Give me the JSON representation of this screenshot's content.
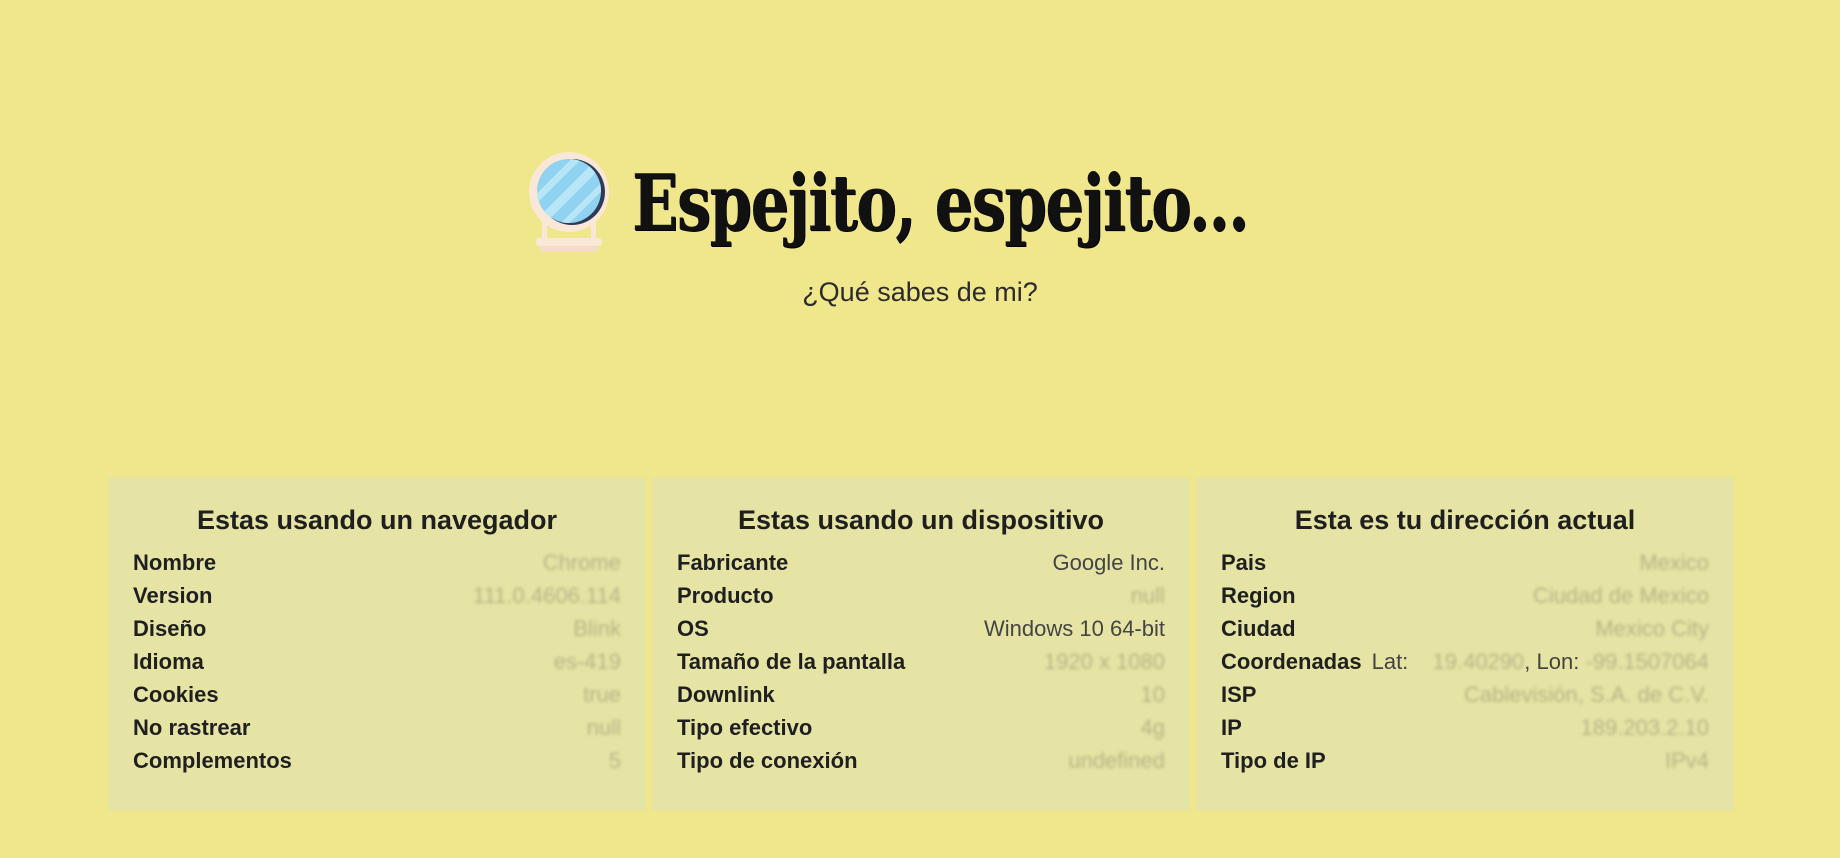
{
  "header": {
    "title": "Espejito, espejito...",
    "subtitle": "¿Qué sabes de mi?",
    "icon": "mirror-icon"
  },
  "cards": [
    {
      "title": "Estas usando un navegador",
      "rows": [
        {
          "label": "Nombre",
          "value": "Chrome"
        },
        {
          "label": "Version",
          "value": "111.0.4606.114"
        },
        {
          "label": "Diseño",
          "value": "Blink"
        },
        {
          "label": "Idioma",
          "value": "es-419"
        },
        {
          "label": "Cookies",
          "value": "true"
        },
        {
          "label": "No rastrear",
          "value": "null"
        },
        {
          "label": "Complementos",
          "value": "5"
        }
      ]
    },
    {
      "title": "Estas usando un dispositivo",
      "rows": [
        {
          "label": "Fabricante",
          "value": "Google Inc."
        },
        {
          "label": "Producto",
          "value": "null"
        },
        {
          "label": "OS",
          "value": "Windows 10 64-bit"
        },
        {
          "label": "Tamaño de la pantalla",
          "value": "1920 x 1080"
        },
        {
          "label": "Downlink",
          "value": "10"
        },
        {
          "label": "Tipo efectivo",
          "value": "4g"
        },
        {
          "label": "Tipo de conexión",
          "value": "undefined"
        }
      ]
    },
    {
      "title": "Esta es tu dirección actual",
      "rows": [
        {
          "label": "Pais",
          "value": "Mexico"
        },
        {
          "label": "Region",
          "value": "Ciudad de Mexico"
        },
        {
          "label": "Ciudad",
          "value": "Mexico City"
        },
        {
          "label": "Coordenadas",
          "lat_label": "Lat:",
          "lat_value": "19.40290",
          "lon_label": ", Lon:",
          "lon_value": "-99.1507064"
        },
        {
          "label": "ISP",
          "value": "Cablevisión, S.A. de C.V."
        },
        {
          "label": "IP",
          "value": "189.203.2.10"
        },
        {
          "label": "Tipo de IP",
          "value": "IPv4"
        }
      ]
    }
  ]
}
